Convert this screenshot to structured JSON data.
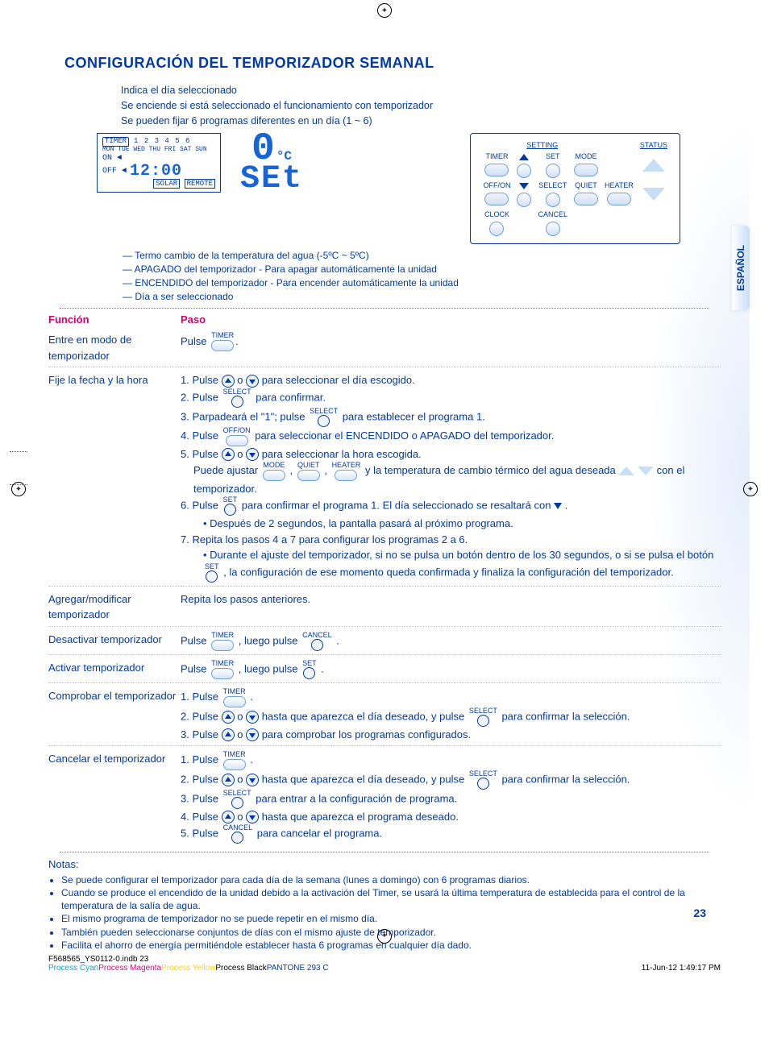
{
  "title": "CONFIGURACIÓN DEL TEMPORIZADOR SEMANAL",
  "language_tab": "ESPAÑOL",
  "page_number": "23",
  "intro": {
    "l1": "Indica el día seleccionado",
    "l2": "Se enciende si está seleccionado el funcionamiento con temporizador",
    "l3": "Se pueden fijar 6 programas diferentes en un día (1 ~ 6)"
  },
  "lcd": {
    "timer_label": "TIMER",
    "program_numbers": "1 2 3 4 5 6",
    "days": "MON TUE WED THU FRI SAT SUN",
    "on": "ON ◄",
    "off": "OFF ◄",
    "clock": "12:00",
    "solar": "SOLAR",
    "remote": "REMOTE"
  },
  "seg": {
    "unit": "°C",
    "top_digit": "0",
    "bottom_text": "SEt"
  },
  "panel": {
    "setting": "SETTING",
    "status": "STATUS",
    "timer": "TIMER",
    "set": "SET",
    "mode": "MODE",
    "offon": "OFF/ON",
    "select": "SELECT",
    "quiet": "QUIET",
    "heater": "HEATER",
    "clock": "CLOCK",
    "cancel": "CANCEL"
  },
  "annot": {
    "a1": "Termo cambio de la temperatura del agua (-5ºC ~ 5ºC)",
    "a2": "APAGADO del temporizador - Para apagar automáticamente la unidad",
    "a3": "ENCENDIDO del temporizador - Para encender automáticamente la unidad",
    "a4": "Día a ser seleccionado"
  },
  "headers": {
    "funcion": "Función",
    "paso": "Paso"
  },
  "rows": {
    "r1": {
      "func": "Entre en modo de temporizador",
      "p_pre": "Pulse "
    },
    "r2": {
      "func": "Fije la fecha y la hora",
      "s1_pre": "1. Pulse ",
      "s1_mid": " o ",
      "s1_post": " para seleccionar el día escogido.",
      "s2_pre": "2. Pulse ",
      "s2_post": " para confirmar.",
      "s3_pre": "3. Parpadeará el \"1\"; pulse ",
      "s3_post": " para establecer el programa 1.",
      "s4_pre": "4. Pulse ",
      "s4_post": " para seleccionar el ENCENDIDO o APAGADO del temporizador.",
      "s5_pre": "5. Pulse ",
      "s5_mid": " o ",
      "s5_post": " para seleccionar la hora escogida.",
      "s5b_pre": "Puede ajustar ",
      "s5b_mid1": ", ",
      "s5b_mid2": ", ",
      "s5b_post": " y la temperatura de cambio térmico del agua deseada ",
      "s5b_tail": " con el temporizador.",
      "s6_pre": "6. Pulse ",
      "s6_post": " para confirmar el programa 1. El día seleccionado se resaltará con ",
      "s6_tail": " .",
      "s6b": "Después de 2 segundos, la pantalla pasará al próximo programa.",
      "s7": "7. Repita los pasos 4 a 7 para configurar los programas 2 a 6.",
      "s7b_pre": "Durante el ajuste del temporizador, si no se pulsa un botón dentro de los 30 segundos, o si se pulsa el botón ",
      "s7b_post": ", la configuración de ese momento queda confirmada y finaliza la configuración del temporizador."
    },
    "r3": {
      "func": "Agregar/modificar temporizador",
      "p": "Repita los pasos anteriores."
    },
    "r4": {
      "func": "Desactivar temporizador",
      "p_pre": "Pulse ",
      "p_mid": ", luego pulse ",
      "p_post": " ."
    },
    "r5": {
      "func": "Activar temporizador",
      "p_pre": "Pulse ",
      "p_mid": ", luego pulse ",
      "p_post": "."
    },
    "r6": {
      "func": "Comprobar el temporizador",
      "s1_pre": "1. Pulse ",
      "s1_post": ".",
      "s2_pre": "2. Pulse ",
      "s2_mid": " o ",
      "s2_mid2": " hasta que aparezca el día deseado, y pulse ",
      "s2_post": " para confirmar la selección.",
      "s3_pre": "3. Pulse ",
      "s3_mid": " o ",
      "s3_post": " para comprobar los programas configurados."
    },
    "r7": {
      "func": "Cancelar el temporizador",
      "s1_pre": "1. Pulse ",
      "s1_post": ".",
      "s2_pre": "2. Pulse ",
      "s2_mid": " o ",
      "s2_mid2": " hasta que aparezca el día deseado, y pulse ",
      "s2_post": " para confirmar la selección.",
      "s3_pre": "3. Pulse ",
      "s3_post": " para entrar a la configuración de programa.",
      "s4_pre": "4. Pulse ",
      "s4_mid": " o ",
      "s4_post": " hasta que aparezca el programa deseado.",
      "s5_pre": "5. Pulse ",
      "s5_post": " para cancelar el programa."
    }
  },
  "notes": {
    "title": "Notas:",
    "n1": "Se puede configurar el temporizador para cada día de la semana (lunes a domingo) con 6 programas diarios.",
    "n2": "Cuando se produce el encendido de la unidad debido a la activación del Timer, se usará la última temperatura de establecida para el control de la temperatura de la salía de agua.",
    "n3": "El mismo programa de temporizador no se puede repetir en el mismo día.",
    "n4": "También pueden seleccionarse conjuntos de días con el mismo ajuste de temporizador.",
    "n5": "Facilita el ahorro de energía permitiéndole establecer hasta 6 programas en cualquier día dado."
  },
  "footer": {
    "file": "F568565_YS0112-0.indb   23",
    "date": "11-Jun-12   1:49:17 PM",
    "c1": "Process Cyan",
    "c2": "Process Magenta",
    "c3": "Process Yellow",
    "c4": "Process Black",
    "c5": "PANTONE 293 C"
  },
  "labels": {
    "TIMER": "TIMER",
    "SELECT": "SELECT",
    "OFFON": "OFF/ON",
    "SET": "SET",
    "MODE": "MODE",
    "QUIET": "QUIET",
    "HEATER": "HEATER",
    "CANCEL": "CANCEL"
  }
}
